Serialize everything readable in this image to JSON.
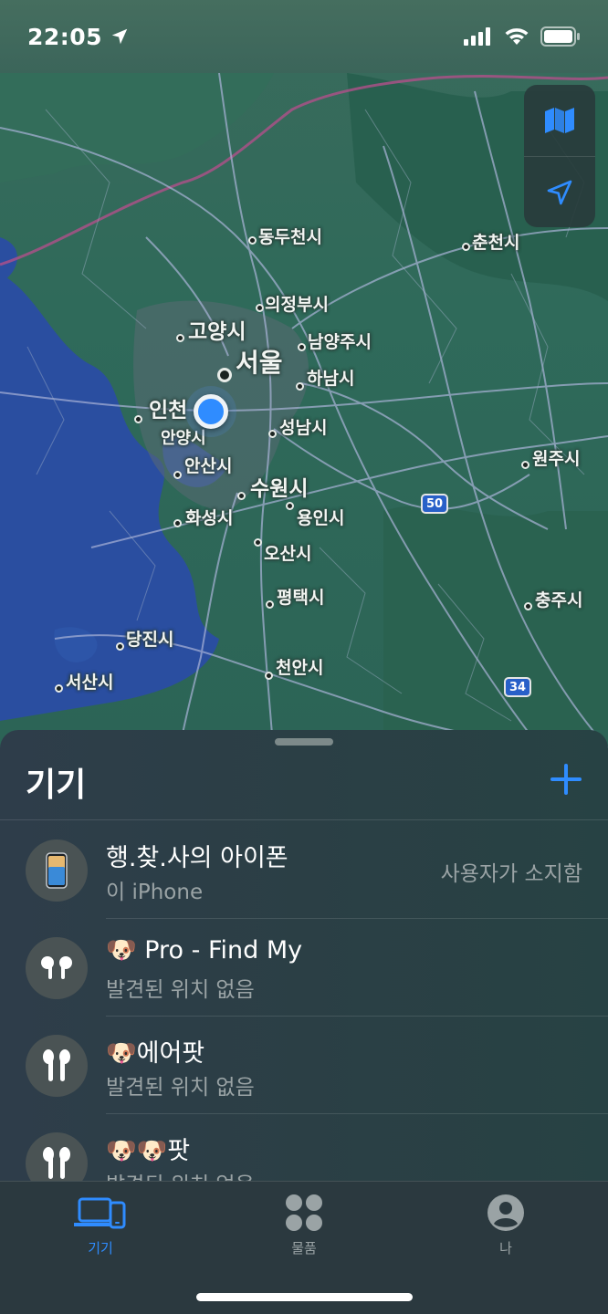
{
  "status_bar": {
    "time": "22:05",
    "icons": [
      "location-arrow-icon",
      "signal-bars-icon",
      "wifi-icon",
      "battery-icon"
    ]
  },
  "map": {
    "controls": [
      "map-icon",
      "location-arrow-icon"
    ],
    "cities": [
      {
        "label": "동두천시",
        "size": "small"
      },
      {
        "label": "춘천시",
        "size": "small"
      },
      {
        "label": "의정부시",
        "size": "small"
      },
      {
        "label": "고양시",
        "size": "mid"
      },
      {
        "label": "남양주시",
        "size": "small"
      },
      {
        "label": "서울",
        "size": "big"
      },
      {
        "label": "하남시",
        "size": "small"
      },
      {
        "label": "인천",
        "size": "mid"
      },
      {
        "label": "안양시",
        "size": "small"
      },
      {
        "label": "성남시",
        "size": "small"
      },
      {
        "label": "원주시",
        "size": "small"
      },
      {
        "label": "안산시",
        "size": "small"
      },
      {
        "label": "수원시",
        "size": "mid"
      },
      {
        "label": "용인시",
        "size": "small"
      },
      {
        "label": "화성시",
        "size": "small"
      },
      {
        "label": "오산시",
        "size": "small"
      },
      {
        "label": "평택시",
        "size": "small"
      },
      {
        "label": "충주시",
        "size": "small"
      },
      {
        "label": "당진시",
        "size": "small"
      },
      {
        "label": "천안시",
        "size": "small"
      },
      {
        "label": "서산시",
        "size": "small"
      }
    ],
    "highways": [
      "50",
      "34"
    ]
  },
  "sheet": {
    "title": "기기",
    "add_icon": "plus-icon",
    "devices": [
      {
        "name": "행.찾.사의 아이폰",
        "subtitle": "이 iPhone",
        "meta": "사용자가 소지함",
        "icon": "iphone-icon"
      },
      {
        "name": "🐶 Pro - Find My",
        "subtitle": "발견된 위치 없음",
        "meta": "",
        "icon": "airpods-pro-icon"
      },
      {
        "name": "🐶에어팟",
        "subtitle": "발견된 위치 없음",
        "meta": "",
        "icon": "airpods-icon"
      },
      {
        "name": "🐶🐶팟",
        "subtitle": "발견된 위치 없음",
        "meta": "",
        "icon": "airpods-icon"
      }
    ]
  },
  "tab_bar": {
    "tabs": [
      {
        "label": "기기",
        "icon": "devices-icon",
        "active": true
      },
      {
        "label": "물품",
        "icon": "items-icon",
        "active": false
      },
      {
        "label": "나",
        "icon": "person-icon",
        "active": false
      }
    ],
    "accent_color": "#2f8cff"
  }
}
